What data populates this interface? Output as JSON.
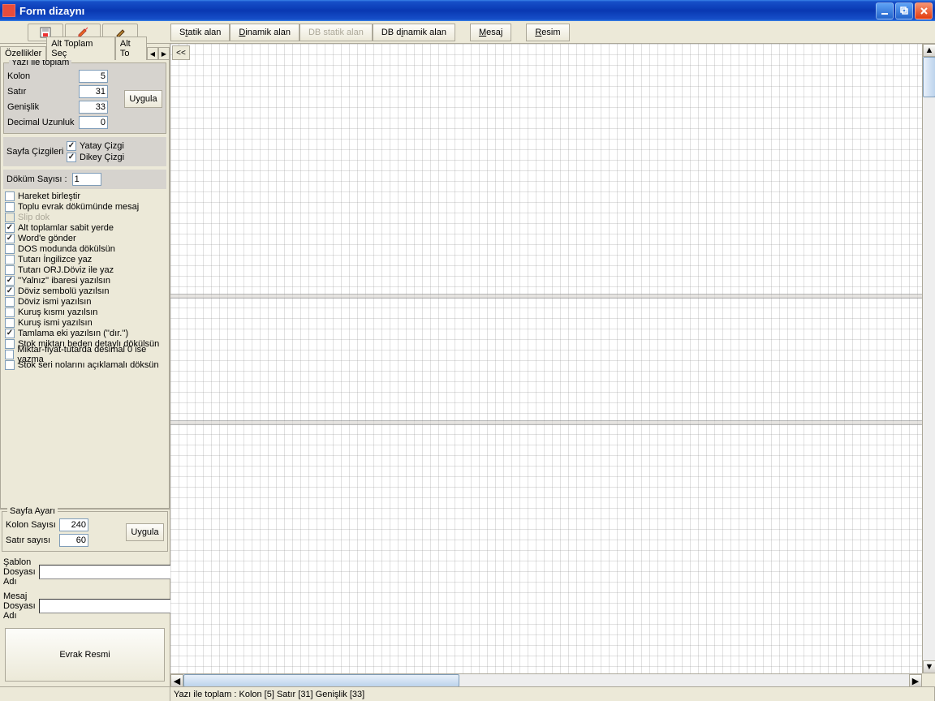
{
  "window": {
    "title": "Form dizaynı"
  },
  "toolbar": {
    "buttons": {
      "static": "Statik alan",
      "dynamic": "Dinamik alan",
      "db_static": "DB statik alan",
      "db_dynamic": "DB dinamik alan",
      "mesaj": "Mesaj",
      "resim": "Resim"
    }
  },
  "tabs": {
    "t0": "Özellikler",
    "t1": "Alt Toplam Seç",
    "t2": "Alt To"
  },
  "yazi_toplam": {
    "legend": "Yazı ile toplam",
    "kolon_label": "Kolon",
    "kolon": "5",
    "satir_label": "Satır",
    "satir": "31",
    "genislik_label": "Genişlik",
    "genislik": "33",
    "decimal_label": "Decimal Uzunluk",
    "decimal": "0",
    "uygula": "Uygula"
  },
  "sayfa_cizgi": {
    "label": "Sayfa Çizgileri",
    "yatay": "Yatay Çizgi",
    "dikey": "Dikey Çizgi"
  },
  "dokum": {
    "label": "Döküm Sayısı :",
    "value": "1"
  },
  "options": {
    "o0": "Hareket birleştir",
    "o1": "Toplu evrak dökümünde mesaj",
    "o2": "Slip dok",
    "o3": "Alt toplamlar sabit yerde",
    "o4": "Word'e gönder",
    "o5": "DOS modunda dökülsün",
    "o6": "Tutarı İngilizce yaz",
    "o7": "Tutarı ORJ.Döviz ile yaz",
    "o8": "''Yalnız'' ibaresi yazılsın",
    "o9": "Döviz sembolü yazılsın",
    "o10": "Döviz ismi yazılsın",
    "o11": "Kuruş kısmı yazılsın",
    "o12": "Kuruş ismi yazılsın",
    "o13": "Tamlama eki yazılsın (''dır.'')",
    "o14": "Stok miktarı beden detaylı dökülsün",
    "o15": "Miktar-fiyat-tutarda desimal 0 ise yazma",
    "o16": "Stok seri nolarını açıklamalı döksün"
  },
  "sayfa_ayari": {
    "legend": "Sayfa Ayarı",
    "kolon_label": "Kolon Sayısı",
    "kolon": "240",
    "satir_label": "Satır sayısı",
    "satir": "60",
    "uygula": "Uygula"
  },
  "files": {
    "sablon_label": "Şablon Dosyası Adı",
    "mesaj_label": "Mesaj Dosyası Adı"
  },
  "evrak": "Evrak Resmi",
  "nav": "<<",
  "status": "Yazı ile toplam  : Kolon [5]  Satır [31]  Genişlik [33]"
}
